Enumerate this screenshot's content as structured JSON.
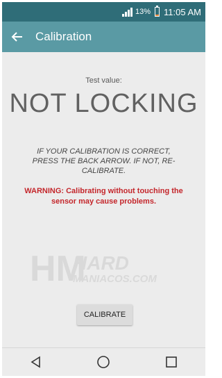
{
  "status_bar": {
    "battery_percent": "13%",
    "time": "11:05 AM",
    "battery_level": 0.13,
    "battery_color": "#ff8a3d"
  },
  "app_bar": {
    "title": "Calibration",
    "back_icon": "arrow-left-icon",
    "color": "#5a9aa4"
  },
  "main": {
    "test_label": "Test value:",
    "test_value": "NOT LOCKING",
    "instructions": "IF YOUR CALIBRATION IS CORRECT, PRESS THE BACK ARROW. IF NOT, RE-CALIBRATE.",
    "warning": "WARNING: Calibrating without touching the sensor may cause problems.",
    "warning_color": "#c4262b",
    "calibrate_label": "CALIBRATE"
  },
  "watermark": {
    "logo": "HM",
    "brand": "HARD",
    "sub": "MANIACOS.COM"
  },
  "nav_bar": {
    "back_icon": "triangle-back-icon",
    "home_icon": "circle-home-icon",
    "recents_icon": "square-recents-icon"
  }
}
